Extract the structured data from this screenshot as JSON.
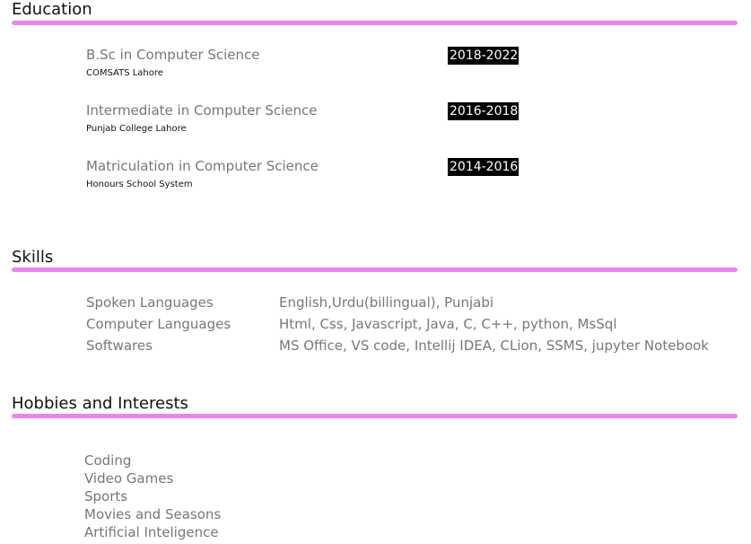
{
  "education": {
    "title": "Education",
    "items": [
      {
        "degree": "B.Sc in Computer Science",
        "school": "COMSATS Lahore",
        "years": "2018-2022"
      },
      {
        "degree": "Intermediate in Computer Science",
        "school": "Punjab College Lahore",
        "years": "2016-2018"
      },
      {
        "degree": "Matriculation in Computer Science",
        "school": "Honours School System",
        "years": "2014-2016"
      }
    ]
  },
  "skills": {
    "title": "Skills",
    "items": [
      {
        "label": "Spoken Languages",
        "value": "English,Urdu(billingual), Punjabi"
      },
      {
        "label": "Computer Languages",
        "value": "Html, Css, Javascript, Java, C, C++, python, MsSql"
      },
      {
        "label": "Softwares",
        "value": "MS Office, VS code, Intellij IDEA, CLion, SSMS, jupyter Notebook"
      }
    ]
  },
  "hobbies": {
    "title": "Hobbies and Interests",
    "items": [
      "Coding",
      "Video Games",
      "Sports",
      "Movies and Seasons",
      "Artificial Inteligence"
    ]
  },
  "colors": {
    "accent": "#ee82ee",
    "muted_text": "#777777",
    "badge_bg": "#000000"
  }
}
